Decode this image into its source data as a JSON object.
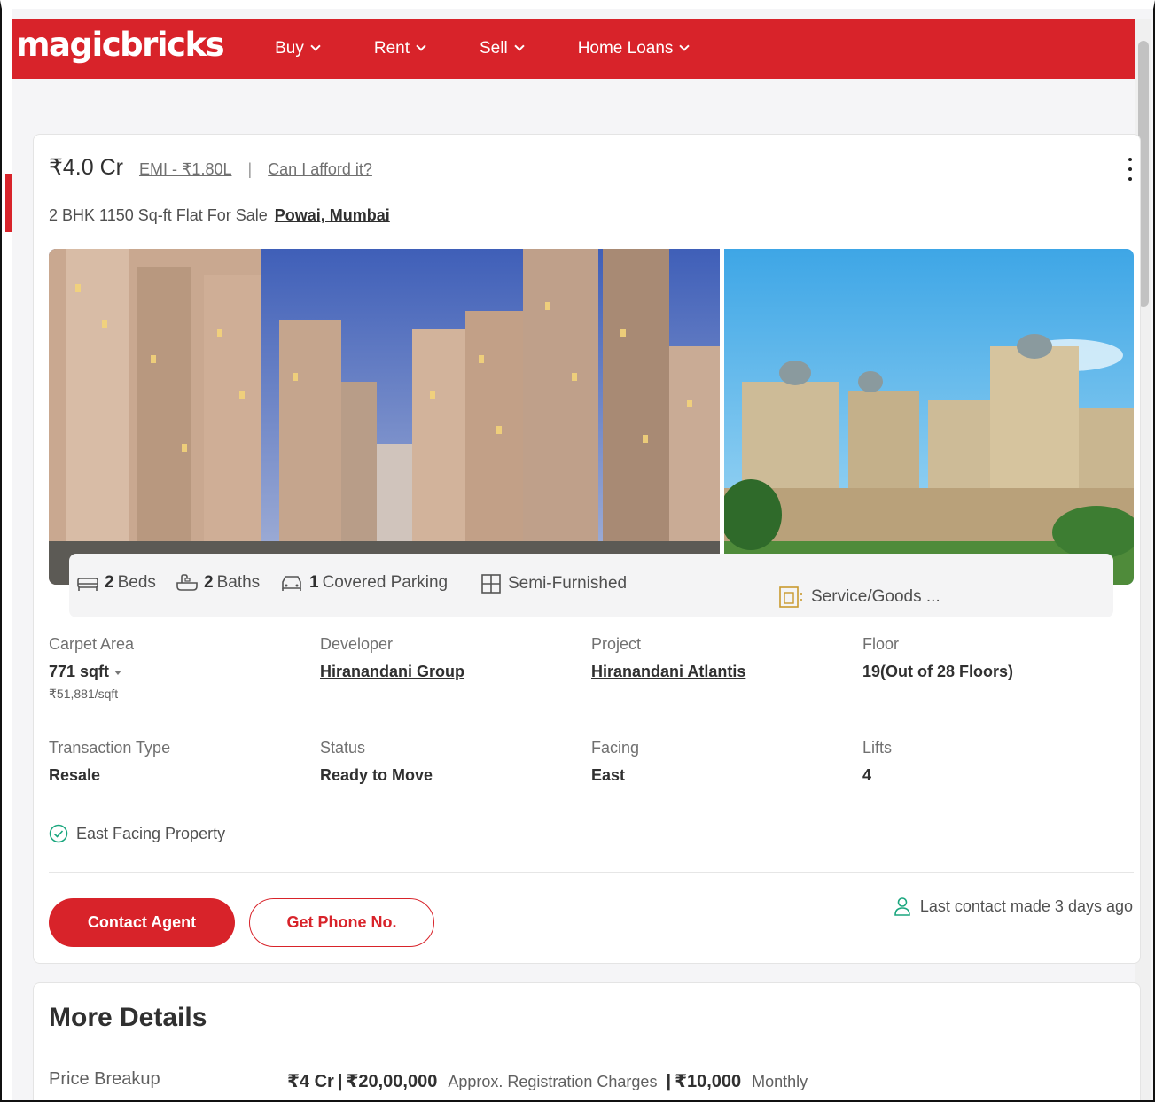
{
  "header": {
    "logo": "magicbricks",
    "nav": [
      {
        "label": "Buy"
      },
      {
        "label": "Rent"
      },
      {
        "label": "Sell"
      },
      {
        "label": "Home Loans"
      }
    ]
  },
  "listing": {
    "price": "₹4.0 Cr",
    "emi": "EMI - ₹1.80L",
    "separator": "|",
    "afford_link": "Can I afford it?",
    "subtitle": "2 BHK 1150 Sq-ft Flat For Sale",
    "location": "Powai, Mumbai",
    "amenities": {
      "beds_count": "2",
      "beds_label": "Beds",
      "baths_count": "2",
      "baths_label": "Baths",
      "parking_count": "1",
      "parking_label": "Covered Parking",
      "furnishing": "Semi-Furnished",
      "service": "Service/Goods ..."
    },
    "details": {
      "carpet_area_label": "Carpet Area",
      "carpet_area_value": "771 sqft",
      "price_per_sqft": "₹51,881/sqft",
      "developer_label": "Developer",
      "developer_value": "Hiranandani Group",
      "project_label": "Project",
      "project_value": "Hiranandani Atlantis",
      "floor_label": "Floor",
      "floor_value": "19(Out of 28 Floors)",
      "transaction_label": "Transaction Type",
      "transaction_value": "Resale",
      "status_label": "Status",
      "status_value": "Ready to Move",
      "facing_label": "Facing",
      "facing_value": "East",
      "lifts_label": "Lifts",
      "lifts_value": "4"
    },
    "feature": "East Facing Property",
    "contact_button": "Contact Agent",
    "phone_button": "Get Phone No.",
    "last_contact": "Last contact made 3 days ago"
  },
  "more_details": {
    "title": "More Details",
    "price_breakup_label": "Price Breakup",
    "price": "₹4 Cr",
    "registration": "₹20,00,000",
    "registration_label": "Approx. Registration Charges",
    "monthly": "₹10,000",
    "monthly_label": "Monthly"
  },
  "colors": {
    "brand": "#d8232a",
    "text": "#303030",
    "muted": "#707070",
    "success": "#1aa67e"
  },
  "icons": [
    "chevron-down-icon",
    "kebab-menu-icon",
    "bed-icon",
    "bath-icon",
    "car-icon",
    "furniture-icon",
    "elevator-icon",
    "check-circle-icon",
    "user-icon"
  ]
}
